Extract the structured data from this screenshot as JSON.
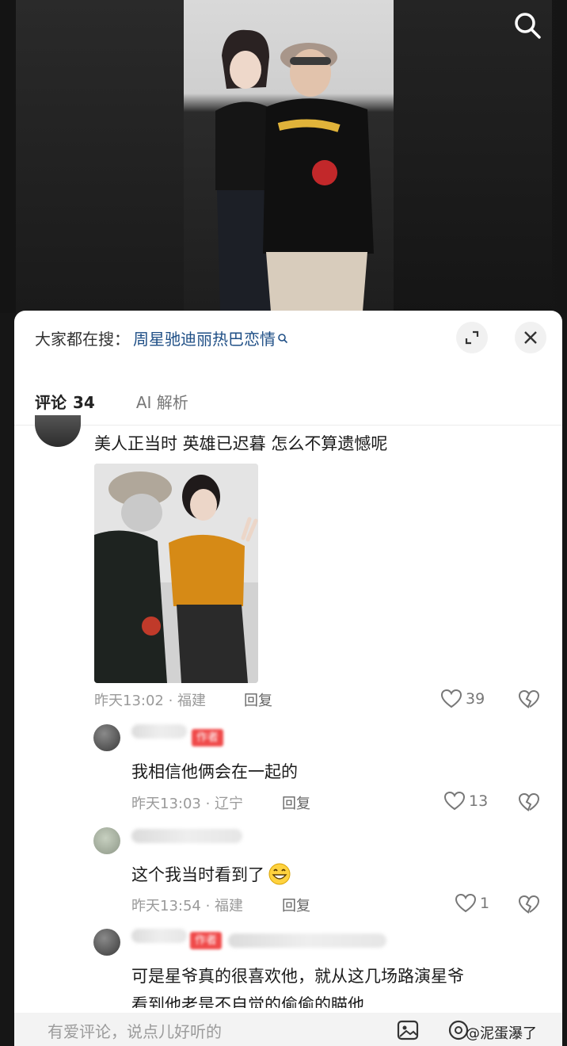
{
  "search_bar": {
    "prefix": "大家都在搜：",
    "query": "周星驰迪丽热巴恋情"
  },
  "tabs": {
    "comments_label": "评论",
    "comments_count": "34",
    "ai_label": "AI 解析"
  },
  "comments": [
    {
      "text": "美人正当时 英雄已迟暮 怎么不算遗憾呢",
      "time": "昨天13:02",
      "location": "福建",
      "reply_label": "回复",
      "likes": "39"
    },
    {
      "text": "我相信他俩会在一起的",
      "time": "昨天13:03",
      "location": "辽宁",
      "reply_label": "回复",
      "likes": "13"
    },
    {
      "text": "这个我当时看到了",
      "time": "昨天13:54",
      "location": "福建",
      "reply_label": "回复",
      "likes": "1"
    },
    {
      "text_line1": "可是星爷真的很喜欢他，就从这几场路演星爷",
      "text_line2": "看到他老是不自觉的偷偷的瞄他"
    }
  ],
  "badge": {
    "author": "作者"
  },
  "input": {
    "placeholder": "有爱评论，说点儿好听的"
  },
  "watermark": {
    "handle": "@泥蛋瀑了"
  },
  "colors": {
    "search_link": "#1f4f86",
    "badge": "#f04a4a",
    "meta": "#9a9a9a"
  },
  "icons": [
    "search-icon",
    "expand-icon",
    "close-icon",
    "heart-icon",
    "broken-heart-icon",
    "grin-emoji",
    "image-icon",
    "at-icon"
  ]
}
